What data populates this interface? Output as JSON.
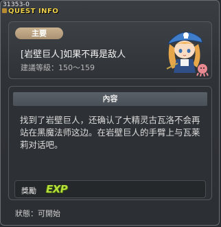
{
  "window": {
    "quest_id": "31353-0",
    "title": "QUEST INFO"
  },
  "header": {
    "tag": "主要",
    "quest_name": "[岩壁巨人]如果不再是敌人",
    "level": "建議等級：150～159"
  },
  "content": {
    "section_title": "內容",
    "description": "找到了岩壁巨人，还确认了大精灵古瓦洛不会再站在黑魔法师这边。在岩壁巨人的手臂上与瓦莱莉对话吧。",
    "reward_label": "獎勵",
    "reward_exp": "EXP"
  },
  "status": {
    "text": "狀態：可開始"
  },
  "colors": {
    "title": "#f0d24a",
    "tag_bg": "#b8a07f",
    "exp": "#b5e03a"
  }
}
